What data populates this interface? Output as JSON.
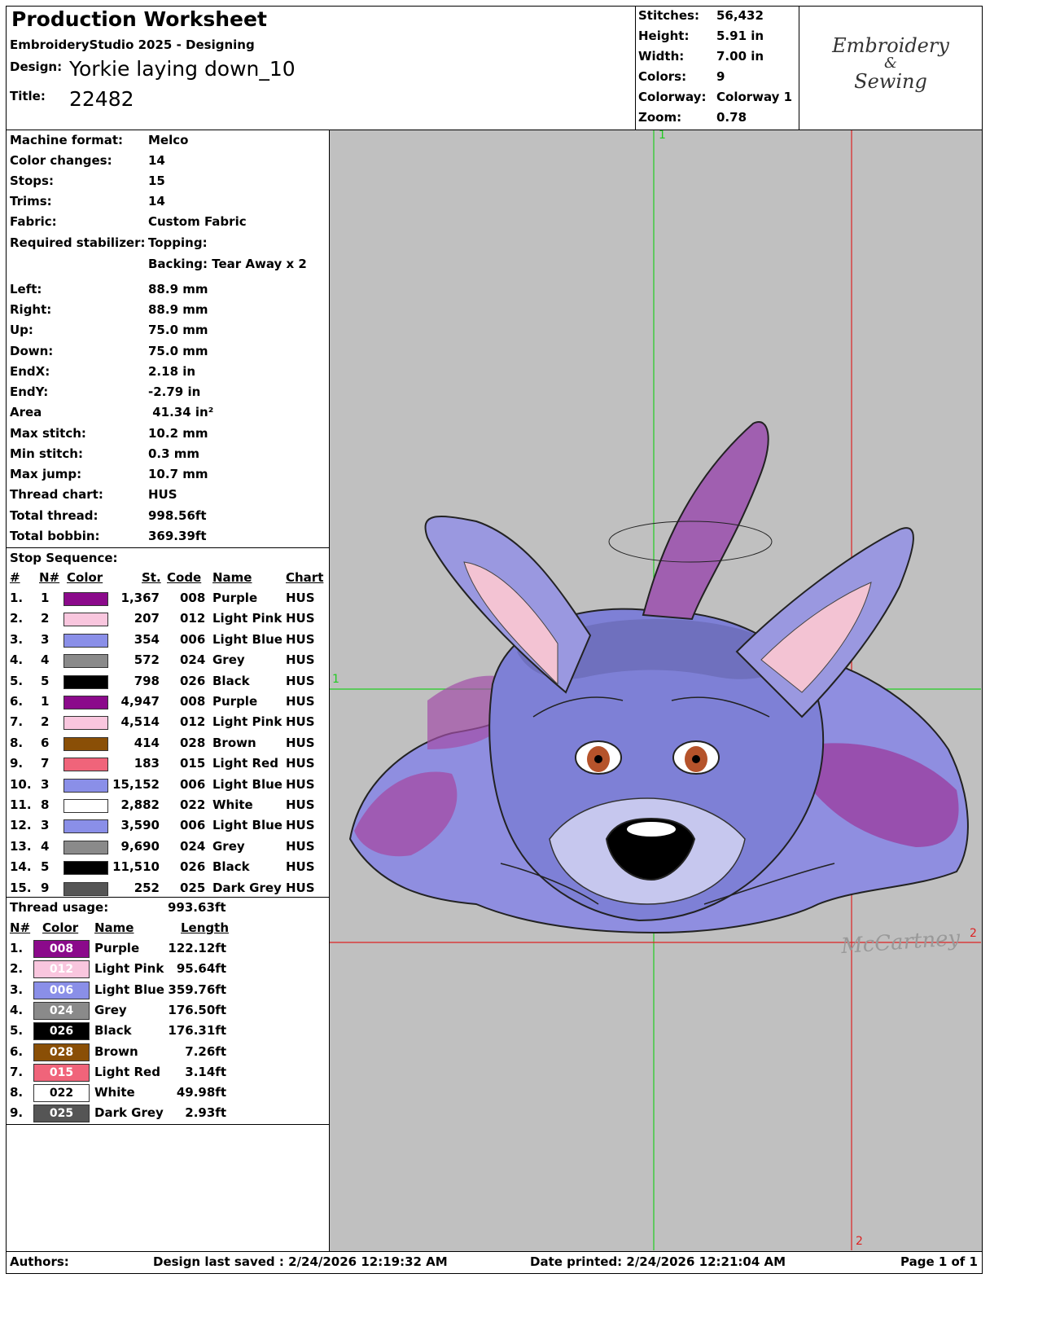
{
  "header": {
    "title": "Production Worksheet",
    "software": "EmbroideryStudio 2025 - Designing",
    "design_label": "Design:",
    "design_value": "Yorkie laying down_10",
    "title_label": "Title:",
    "title_value": "22482"
  },
  "stats": [
    {
      "label": "Stitches:",
      "value": "56,432"
    },
    {
      "label": "Height:",
      "value": "5.91 in"
    },
    {
      "label": "Width:",
      "value": "7.00 in"
    },
    {
      "label": "Colors:",
      "value": "9"
    },
    {
      "label": "Colorway:",
      "value": "Colorway 1"
    },
    {
      "label": "Zoom:",
      "value": "0.78"
    }
  ],
  "logo": {
    "line1": "Embroidery",
    "line2": "&",
    "line3": "Sewing"
  },
  "details": [
    {
      "label": "Machine format:",
      "value": "Melco"
    },
    {
      "label": "Color changes:",
      "value": "14"
    },
    {
      "label": "Stops:",
      "value": "15"
    },
    {
      "label": "Trims:",
      "value": "14"
    },
    {
      "label": "Fabric:",
      "value": "Custom Fabric"
    },
    {
      "label": "Required stabilizer:",
      "value": "Topping:"
    },
    {
      "label": "",
      "value": "Backing: Tear Away x 2"
    },
    {
      "label": "Left:",
      "value": "88.9 mm"
    },
    {
      "label": "Right:",
      "value": "88.9 mm"
    },
    {
      "label": "Up:",
      "value": "75.0 mm"
    },
    {
      "label": "Down:",
      "value": "75.0 mm"
    },
    {
      "label": "EndX:",
      "value": "2.18 in"
    },
    {
      "label": "EndY:",
      "value": "-2.79 in"
    },
    {
      "label": "Area",
      "value": " 41.34 in²"
    },
    {
      "label": "Max stitch:",
      "value": "10.2 mm"
    },
    {
      "label": "Min stitch:",
      "value": "0.3 mm"
    },
    {
      "label": "Max jump:",
      "value": "10.7 mm"
    },
    {
      "label": "Thread chart:",
      "value": "HUS"
    },
    {
      "label": "Total thread:",
      "value": "998.56ft"
    },
    {
      "label": "Total bobbin:",
      "value": "369.39ft"
    }
  ],
  "stop_sequence": {
    "heading": "Stop Sequence:",
    "columns": [
      "#",
      "N#",
      "Color",
      "St.",
      "Code",
      "Name",
      "Chart"
    ],
    "rows": [
      {
        "num": "1.",
        "n": "1",
        "color": "#8b0a8b",
        "st": "1,367",
        "code": "008",
        "name": "Purple",
        "chart": "HUS"
      },
      {
        "num": "2.",
        "n": "2",
        "color": "#f9c6de",
        "st": "207",
        "code": "012",
        "name": "Light Pink",
        "chart": "HUS"
      },
      {
        "num": "3.",
        "n": "3",
        "color": "#8a8fe8",
        "st": "354",
        "code": "006",
        "name": "Light Blue",
        "chart": "HUS"
      },
      {
        "num": "4.",
        "n": "4",
        "color": "#8a8a8a",
        "st": "572",
        "code": "024",
        "name": "Grey",
        "chart": "HUS"
      },
      {
        "num": "5.",
        "n": "5",
        "color": "#000000",
        "st": "798",
        "code": "026",
        "name": "Black",
        "chart": "HUS"
      },
      {
        "num": "6.",
        "n": "1",
        "color": "#8b0a8b",
        "st": "4,947",
        "code": "008",
        "name": "Purple",
        "chart": "HUS"
      },
      {
        "num": "7.",
        "n": "2",
        "color": "#f9c6de",
        "st": "4,514",
        "code": "012",
        "name": "Light Pink",
        "chart": "HUS"
      },
      {
        "num": "8.",
        "n": "6",
        "color": "#8a4f06",
        "st": "414",
        "code": "028",
        "name": "Brown",
        "chart": "HUS"
      },
      {
        "num": "9.",
        "n": "7",
        "color": "#f0647a",
        "st": "183",
        "code": "015",
        "name": "Light Red",
        "chart": "HUS"
      },
      {
        "num": "10.",
        "n": "3",
        "color": "#8a8fe8",
        "st": "15,152",
        "code": "006",
        "name": "Light Blue",
        "chart": "HUS"
      },
      {
        "num": "11.",
        "n": "8",
        "color": "#ffffff",
        "st": "2,882",
        "code": "022",
        "name": "White",
        "chart": "HUS"
      },
      {
        "num": "12.",
        "n": "3",
        "color": "#8a8fe8",
        "st": "3,590",
        "code": "006",
        "name": "Light Blue",
        "chart": "HUS"
      },
      {
        "num": "13.",
        "n": "4",
        "color": "#8a8a8a",
        "st": "9,690",
        "code": "024",
        "name": "Grey",
        "chart": "HUS"
      },
      {
        "num": "14.",
        "n": "5",
        "color": "#000000",
        "st": "11,510",
        "code": "026",
        "name": "Black",
        "chart": "HUS"
      },
      {
        "num": "15.",
        "n": "9",
        "color": "#555555",
        "st": "252",
        "code": "025",
        "name": "Dark Grey",
        "chart": "HUS"
      }
    ]
  },
  "thread_usage": {
    "heading": "Thread usage:",
    "total": "993.63ft",
    "columns": [
      "N#",
      "Color",
      "Name",
      "Length"
    ],
    "rows": [
      {
        "num": "1.",
        "code": "008",
        "color": "#8b0a8b",
        "text": "#ffffff",
        "name": "Purple",
        "length": "122.12ft"
      },
      {
        "num": "2.",
        "code": "012",
        "color": "#f9c6de",
        "text": "#ffffff",
        "name": "Light Pink",
        "length": "95.64ft"
      },
      {
        "num": "3.",
        "code": "006",
        "color": "#8a8fe8",
        "text": "#ffffff",
        "name": "Light Blue",
        "length": "359.76ft"
      },
      {
        "num": "4.",
        "code": "024",
        "color": "#8a8a8a",
        "text": "#ffffff",
        "name": "Grey",
        "length": "176.50ft"
      },
      {
        "num": "5.",
        "code": "026",
        "color": "#000000",
        "text": "#ffffff",
        "name": "Black",
        "length": "176.31ft"
      },
      {
        "num": "6.",
        "code": "028",
        "color": "#8a4f06",
        "text": "#ffffff",
        "name": "Brown",
        "length": "7.26ft"
      },
      {
        "num": "7.",
        "code": "015",
        "color": "#f0647a",
        "text": "#ffffff",
        "name": "Light Red",
        "length": "3.14ft"
      },
      {
        "num": "8.",
        "code": "022",
        "color": "#ffffff",
        "text": "#000000",
        "name": "White",
        "length": "49.98ft"
      },
      {
        "num": "9.",
        "code": "025",
        "color": "#555555",
        "text": "#ffffff",
        "name": "Dark Grey",
        "length": "2.93ft"
      }
    ]
  },
  "canvas": {
    "background": "#c0c0c0",
    "guide_green": "#22cc22",
    "guide_red": "#dd2222",
    "marker_1": "1",
    "marker_2": "2",
    "signature": "McCartney"
  },
  "footer": {
    "authors": "Authors:",
    "saved": "Design last saved : 2/24/2026 12:19:32 AM",
    "printed": "Date printed: 2/24/2026 12:21:04 AM",
    "page": "Page 1 of 1"
  }
}
